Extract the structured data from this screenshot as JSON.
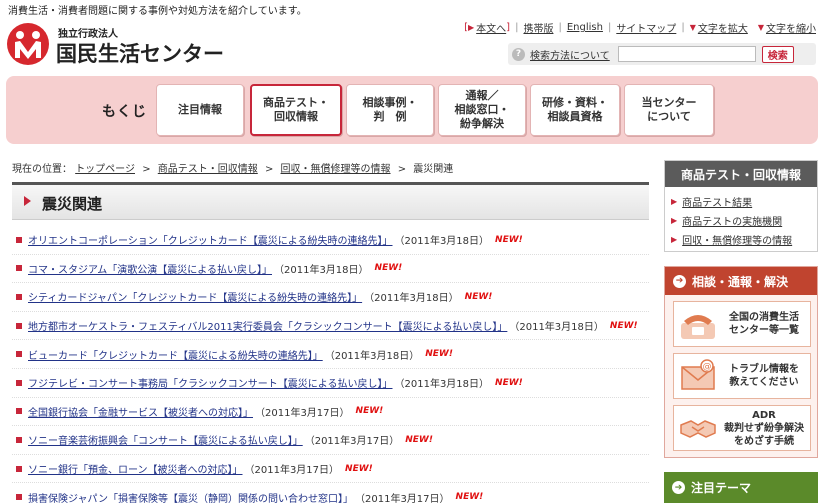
{
  "header": {
    "tagline": "消費生活・消費者問題に関する事例や対処方法を紹介しています。",
    "logo_sub": "独立行政法人",
    "logo_main": "国民生活センター",
    "utility": {
      "text_version": "本文へ",
      "mobile": "携帯版",
      "english": "English",
      "sitemap": "サイトマップ",
      "text_bigger": "文字を拡大",
      "text_smaller": "文字を縮小"
    },
    "search": {
      "help": "検索方法について",
      "placeholder": "",
      "button": "検索"
    }
  },
  "nav": {
    "title": "もくじ",
    "tabs": [
      {
        "label": "注目情報"
      },
      {
        "label": "商品テスト・\n回収情報"
      },
      {
        "label": "相談事例・\n判　例"
      },
      {
        "label": "通報／\n相談窓口・\n紛争解決"
      },
      {
        "label": "研修・資料・\n相談員資格"
      },
      {
        "label": "当センター\nについて"
      }
    ]
  },
  "breadcrumb": {
    "prefix": "現在の位置：",
    "items": [
      "トップページ",
      "商品テスト・回収情報",
      "回収・無償修理等の情報"
    ],
    "current": "震災関連"
  },
  "page_title": "震災関連",
  "news": [
    {
      "title": "オリエントコーポレーション「クレジットカード【震災による紛失時の連絡先】」",
      "date": "（2011年3月18日）",
      "badge": "NEW!"
    },
    {
      "title": "コマ・スタジアム「演歌公演【震災による払い戻し】」",
      "date": "（2011年3月18日）",
      "badge": "NEW!"
    },
    {
      "title": "シティカードジャパン「クレジットカード【震災による紛失時の連絡先】」",
      "date": "（2011年3月18日）",
      "badge": "NEW!"
    },
    {
      "title": "地方都市オーケストラ・フェスティバル2011実行委員会「クラシックコンサート【震災による払い戻し】」",
      "date": "（2011年3月18日）",
      "badge": "NEW!"
    },
    {
      "title": "ビューカード「クレジットカード【震災による紛失時の連絡先】」",
      "date": "（2011年3月18日）",
      "badge": "NEW!"
    },
    {
      "title": "フジテレビ・コンサート事務局「クラシックコンサート【震災による払い戻し】」",
      "date": "（2011年3月18日）",
      "badge": "NEW!"
    },
    {
      "title": "全国銀行協会「金融サービス【被災者への対応】」",
      "date": "（2011年3月17日）",
      "badge": "NEW!"
    },
    {
      "title": "ソニー音楽芸術振興会「コンサート【震災による払い戻し】」",
      "date": "（2011年3月17日）",
      "badge": "NEW!"
    },
    {
      "title": "ソニー銀行「預金、ローン【被災者への対応】」",
      "date": "（2011年3月17日）",
      "badge": "NEW!"
    },
    {
      "title": "損害保険ジャパン「損害保険等【震災（静岡）関係の問い合わせ窓口】」",
      "date": "（2011年3月17日）",
      "badge": "NEW!"
    }
  ],
  "sidebar": {
    "section1": {
      "title": "商品テスト・回収情報",
      "links": [
        "商品テスト結果",
        "商品テストの実施機関",
        "回収・無償修理等の情報"
      ]
    },
    "section2": {
      "title": "相談・通報・解決",
      "banners": [
        {
          "label": "全国の消費生活\nセンター等一覧",
          "icon": "phone-icon"
        },
        {
          "label": "トラブル情報を\n教えてください",
          "icon": "mail-icon"
        },
        {
          "label": "ADR\n裁判せず紛争解決\nをめざす手続",
          "icon": "handshake-icon"
        }
      ]
    },
    "section3": {
      "title": "注目テーマ"
    }
  },
  "colors": {
    "accent": "#c7263a",
    "nav_bg": "#f6cfcf",
    "side_dark": "#5b5b5b",
    "side_orange": "#c0442f",
    "side_green": "#5b8a2a"
  }
}
